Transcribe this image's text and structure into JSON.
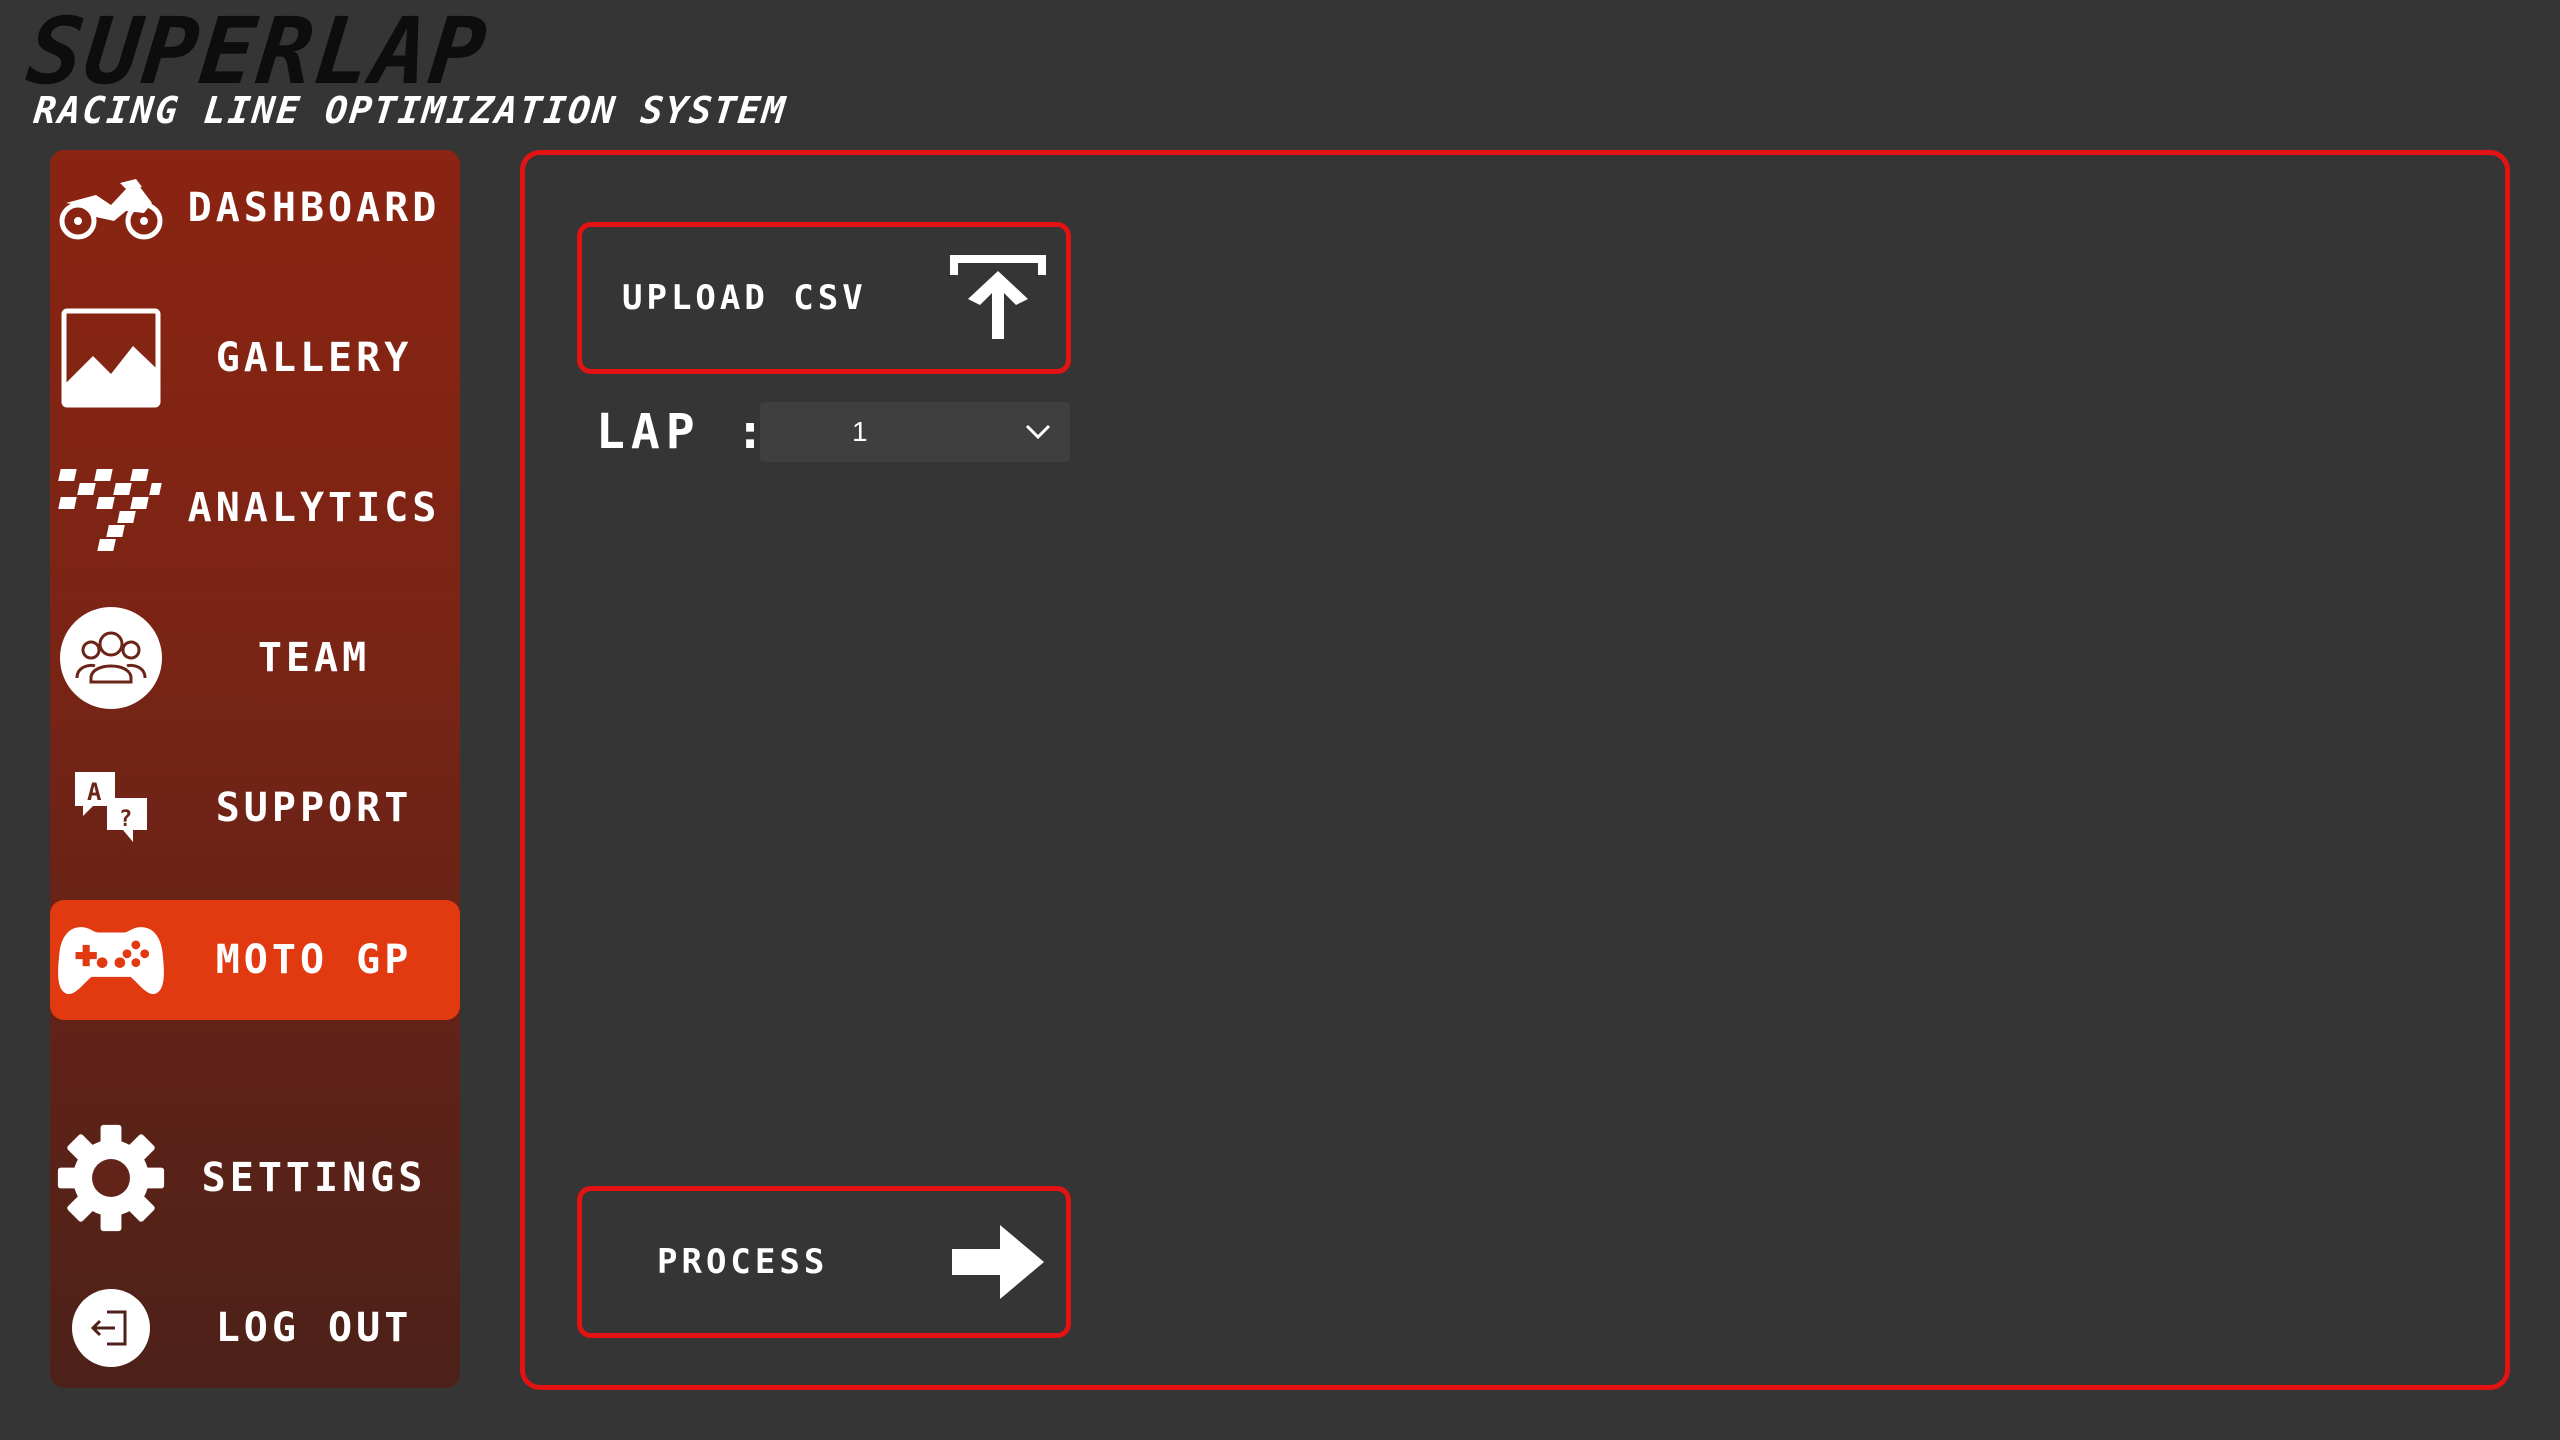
{
  "brand": {
    "title": "SUPERLAP",
    "subtitle": "RACING LINE OPTIMIZATION SYSTEM"
  },
  "sidebar": {
    "items": [
      {
        "label": "DASHBOARD",
        "icon": "motorcycle-icon"
      },
      {
        "label": "GALLERY",
        "icon": "image-icon"
      },
      {
        "label": "ANALYTICS",
        "icon": "checkered-flag-icon"
      },
      {
        "label": "TEAM",
        "icon": "team-icon"
      },
      {
        "label": "SUPPORT",
        "icon": "support-chat-icon"
      },
      {
        "label": "MOTO GP",
        "icon": "gamepad-icon",
        "active": true
      },
      {
        "label": "SETTINGS",
        "icon": "gear-icon"
      },
      {
        "label": "LOG OUT",
        "icon": "logout-icon"
      }
    ]
  },
  "main": {
    "upload_button": {
      "label": "UPLOAD CSV",
      "icon": "upload-icon"
    },
    "lap": {
      "label": "LAP :",
      "selected": "1"
    },
    "process_button": {
      "label": "PROCESS",
      "icon": "arrow-right-icon"
    }
  },
  "colors": {
    "background": "#353535",
    "accent_red": "#e31313",
    "active_item": "#e13a10",
    "sidebar_top": "#8b2412",
    "sidebar_bottom": "#4c2119"
  }
}
